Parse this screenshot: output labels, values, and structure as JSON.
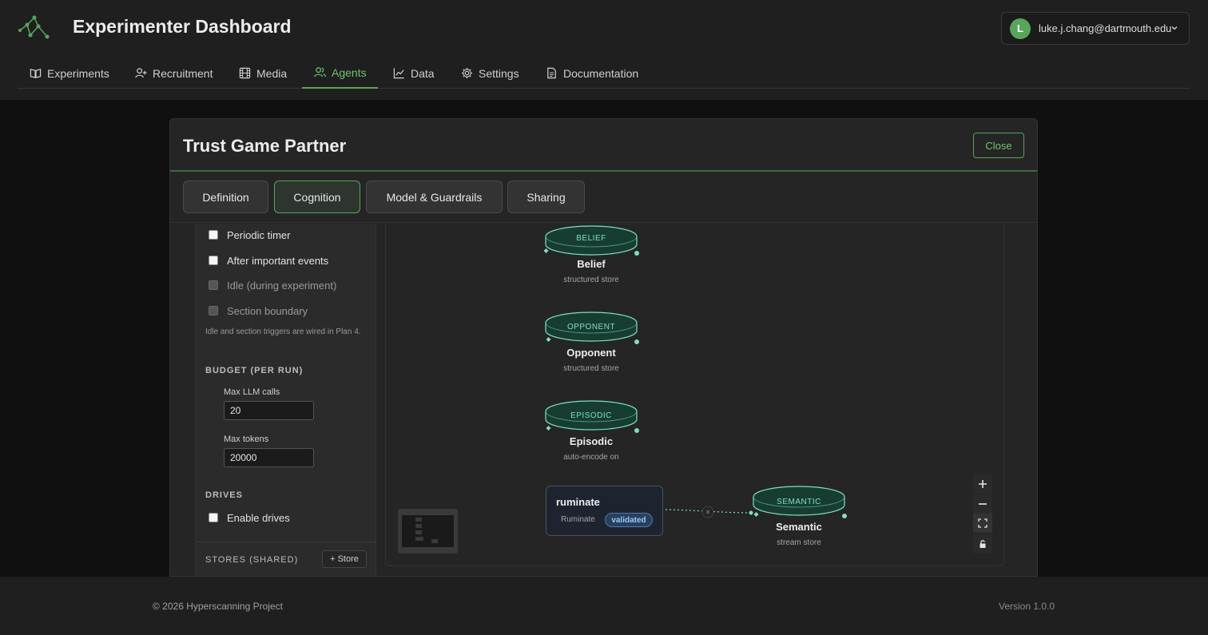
{
  "app": {
    "title": "Experimenter Dashboard",
    "user_initial": "L",
    "user_email": "luke.j.chang@dartmouth.edu"
  },
  "nav": {
    "items": [
      {
        "label": "Experiments",
        "icon": "book-icon"
      },
      {
        "label": "Recruitment",
        "icon": "user-plus-icon"
      },
      {
        "label": "Media",
        "icon": "film-icon"
      },
      {
        "label": "Agents",
        "icon": "users-icon",
        "active": true
      },
      {
        "label": "Data",
        "icon": "chart-icon"
      },
      {
        "label": "Settings",
        "icon": "gear-icon"
      },
      {
        "label": "Documentation",
        "icon": "document-icon"
      }
    ]
  },
  "modal": {
    "title": "Trust Game Partner",
    "close_label": "Close",
    "tabs": [
      {
        "label": "Definition"
      },
      {
        "label": "Cognition",
        "active": true
      },
      {
        "label": "Model & Guardrails"
      },
      {
        "label": "Sharing"
      }
    ]
  },
  "triggers": {
    "items": [
      {
        "label": "Periodic timer",
        "checked": false,
        "disabled": false
      },
      {
        "label": "After important events",
        "checked": false,
        "disabled": false
      },
      {
        "label": "Idle (during experiment)",
        "checked": false,
        "disabled": true
      },
      {
        "label": "Section boundary",
        "checked": false,
        "disabled": true
      }
    ],
    "hint": "Idle and section triggers are wired in Plan 4."
  },
  "budget": {
    "heading": "BUDGET (PER RUN)",
    "max_llm_label": "Max LLM calls",
    "max_llm_value": "20",
    "max_tokens_label": "Max tokens",
    "max_tokens_value": "20000"
  },
  "drives": {
    "heading": "DRIVES",
    "enable_label": "Enable drives"
  },
  "stores": {
    "heading": "STORES (SHARED)",
    "add_label": "+ Store"
  },
  "graph": {
    "nodes": [
      {
        "label": "BELIEF",
        "title": "Belief",
        "sub": "structured store"
      },
      {
        "label": "OPPONENT",
        "title": "Opponent",
        "sub": "structured store"
      },
      {
        "label": "EPISODIC",
        "title": "Episodic",
        "sub": "auto-encode on"
      },
      {
        "label": "SEMANTIC",
        "title": "Semantic",
        "sub": "stream store"
      }
    ],
    "task": {
      "title": "ruminate",
      "sub": "Ruminate",
      "badge": "validated"
    },
    "colors": {
      "accent": "#7fe0c2",
      "cylinder_fill": "#173d33"
    }
  },
  "footer": {
    "copyright": "© 2026 Hyperscanning Project",
    "version": "Version 1.0.0"
  }
}
